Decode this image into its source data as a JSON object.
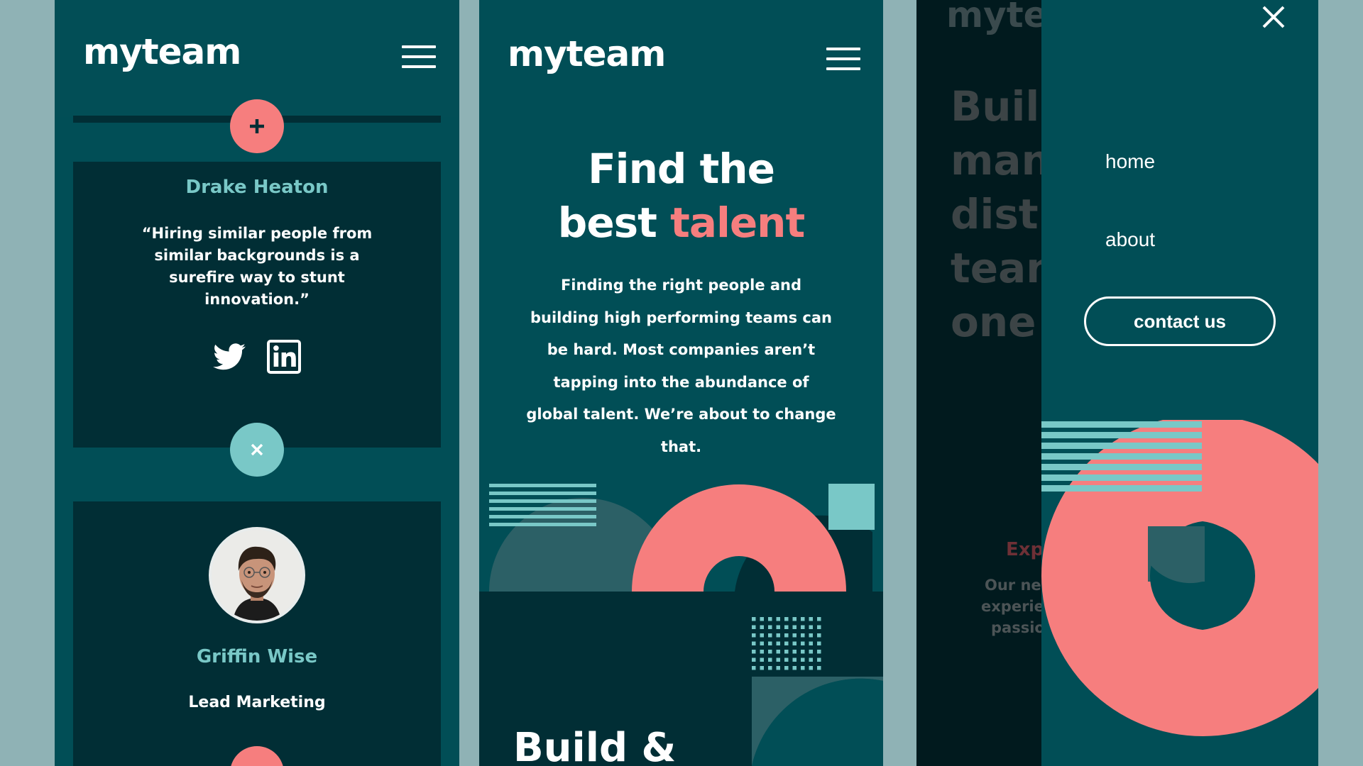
{
  "brand": {
    "name": "myteam"
  },
  "colors": {
    "background": "#8fb2b5",
    "primary_teal": "#014e56",
    "dark_teal": "#012e35",
    "coral": "#f67e7e",
    "light_teal": "#79c8c7",
    "white": "#ffffff"
  },
  "panel1": {
    "header": {
      "logo": "myteam",
      "menu_icon": "hamburger-icon"
    },
    "card_drake": {
      "name": "Drake Heaton",
      "quote": "“Hiring similar people from similar backgrounds is a surefire way to stunt innovation.”",
      "social": [
        "twitter-icon",
        "linkedin-icon"
      ],
      "toggle_icon": "close-icon"
    },
    "card_griffin": {
      "name": "Griffin Wise",
      "role": "Lead Marketing",
      "avatar": "avatar-photo"
    },
    "top_toggle_icon": "plus-icon"
  },
  "panel2": {
    "header": {
      "logo": "myteam",
      "menu_icon": "hamburger-icon"
    },
    "hero": {
      "title_line1": "Find the",
      "title_line2_prefix": "best ",
      "title_line2_accent": "talent",
      "text": "Finding the right people and building high performing teams can be hard. Most companies aren’t tapping into the abundance of global talent. We’re about to change that."
    },
    "section_heading": "Build &"
  },
  "panel3": {
    "ghost": {
      "logo": "myte",
      "headline_lines": [
        "Buil",
        "man",
        "distr",
        "tean",
        "one"
      ],
      "sub_heading": "Exp",
      "sub_text_lines": [
        "Our ne",
        "experie",
        "passio"
      ]
    },
    "menu": {
      "close_icon": "close-icon",
      "items": [
        {
          "label": "home"
        },
        {
          "label": "about"
        }
      ],
      "cta_label": "contact us"
    }
  }
}
